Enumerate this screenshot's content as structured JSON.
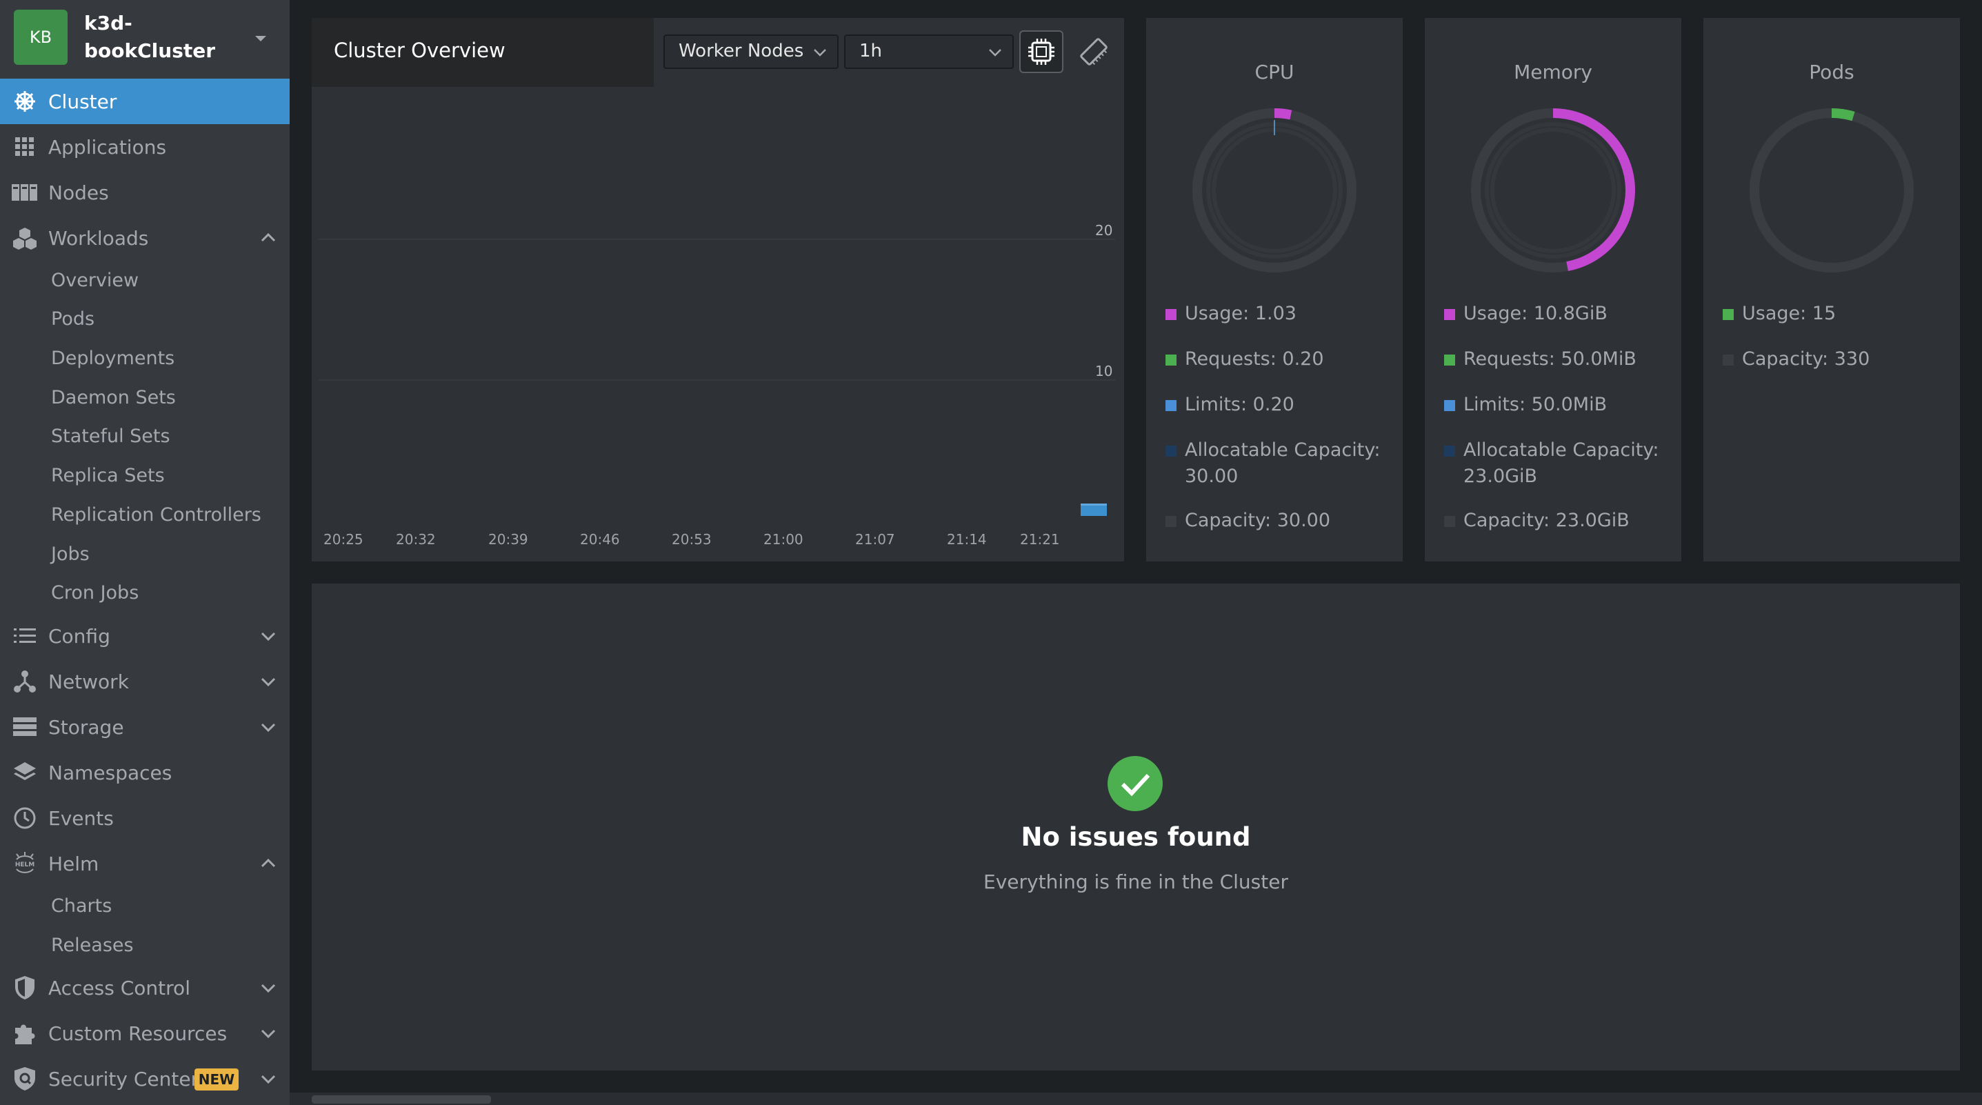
{
  "cluster": {
    "avatar": "KB",
    "name": "k3d-bookCluster"
  },
  "nav": {
    "cluster": "Cluster",
    "applications": "Applications",
    "nodes": "Nodes",
    "workloads": "Workloads",
    "workloads_sub": [
      "Overview",
      "Pods",
      "Deployments",
      "Daemon Sets",
      "Stateful Sets",
      "Replica Sets",
      "Replication Controllers",
      "Jobs",
      "Cron Jobs"
    ],
    "config": "Config",
    "network": "Network",
    "storage": "Storage",
    "namespaces": "Namespaces",
    "events": "Events",
    "helm": "Helm",
    "helm_sub": [
      "Charts",
      "Releases"
    ],
    "access_control": "Access Control",
    "custom_resources": "Custom Resources",
    "security_center": "Security Center",
    "new_badge": "NEW"
  },
  "overview": {
    "title": "Cluster Overview",
    "node_select": "Worker Nodes",
    "range_select": "1h",
    "icons": [
      "cpu-icon",
      "memory-icon"
    ]
  },
  "chart_data": {
    "type": "bar",
    "categories": [
      "20:25",
      "20:32",
      "20:39",
      "20:46",
      "20:53",
      "21:00",
      "21:07",
      "21:14",
      "21:21"
    ],
    "yticks": [
      "20",
      "10"
    ],
    "ylim": [
      0,
      30
    ],
    "values": [
      0,
      0,
      0,
      0,
      0,
      0,
      0,
      0,
      1.03
    ],
    "title": "",
    "xlabel": "",
    "ylabel": ""
  },
  "cards": {
    "cpu": {
      "title": "CPU",
      "usage_fraction": 0.034,
      "legend": [
        "Usage: 1.03",
        "Requests: 0.20",
        "Limits: 0.20",
        "Allocatable Capacity: 30.00",
        "Capacity: 30.00"
      ]
    },
    "memory": {
      "title": "Memory",
      "usage_fraction": 0.47,
      "legend": [
        "Usage: 10.8GiB",
        "Requests: 50.0MiB",
        "Limits: 50.0MiB",
        "Allocatable Capacity: 23.0GiB",
        "Capacity: 23.0GiB"
      ]
    },
    "pods": {
      "title": "Pods",
      "usage_fraction": 0.045,
      "legend": [
        "Usage: 15",
        "Capacity: 330"
      ]
    }
  },
  "colors": {
    "usage": "#c447d1",
    "requests": "#4caf50",
    "limits": "#4a90d9",
    "allocatable": "#1d3a5f",
    "capacity": "#3a3d41",
    "accent": "#3d90ce"
  },
  "issues": {
    "title": "No issues found",
    "subtitle": "Everything is fine in the Cluster"
  }
}
